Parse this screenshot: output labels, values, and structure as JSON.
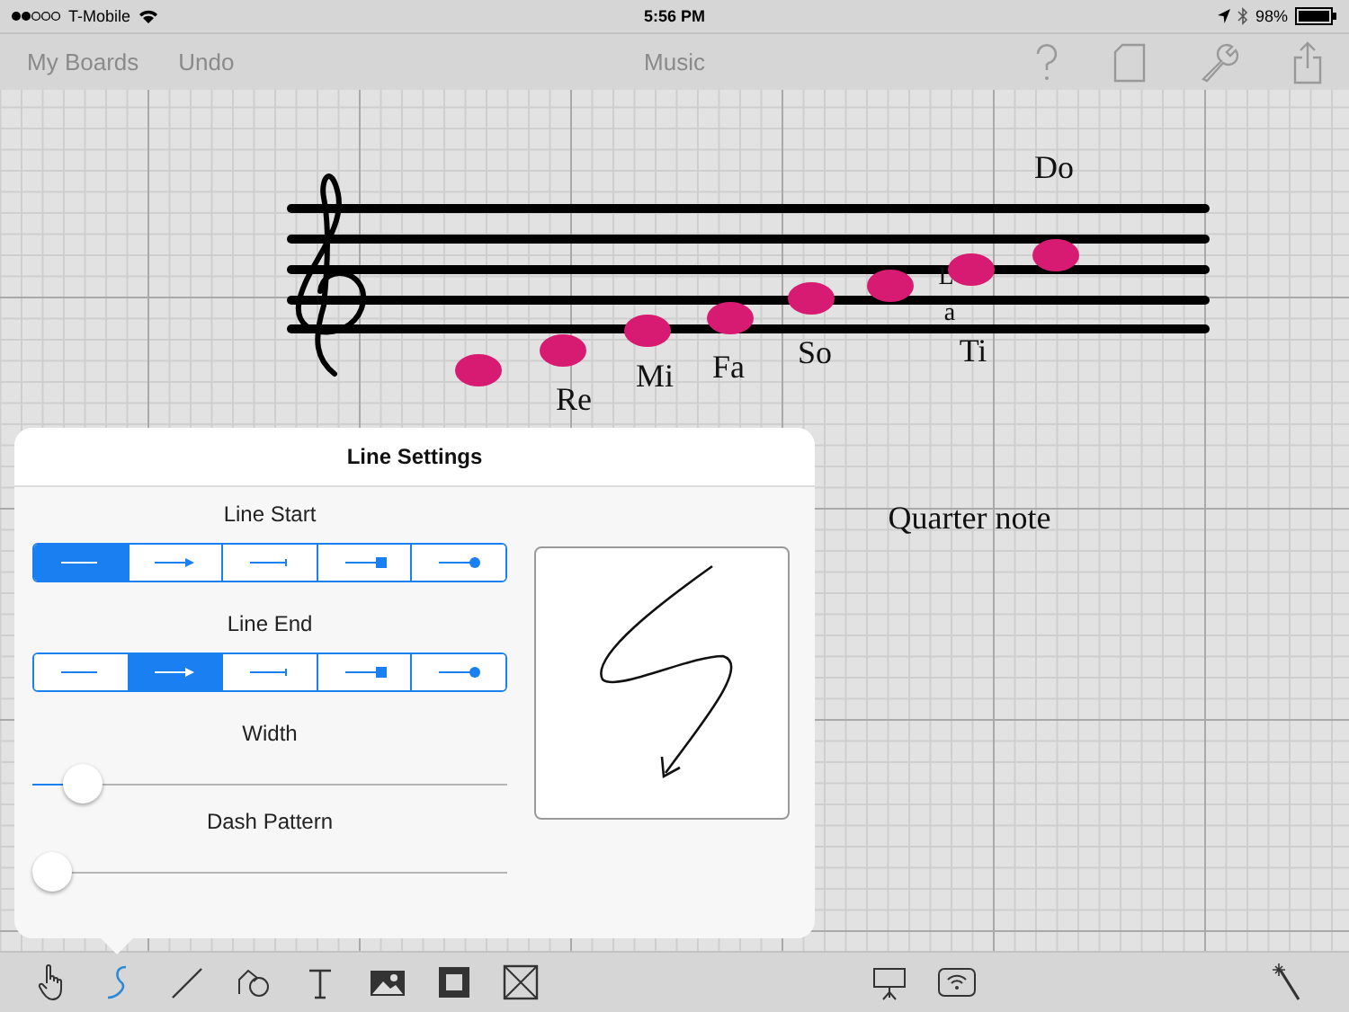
{
  "status_bar": {
    "carrier": "T-Mobile",
    "time": "5:56 PM",
    "battery": "98%"
  },
  "nav_bar": {
    "left_buttons": [
      "My Boards",
      "Undo"
    ],
    "title": "Music"
  },
  "canvas": {
    "labels": [
      "Do",
      "Re",
      "Mi",
      "Fa",
      "So",
      "L",
      "a",
      "Ti",
      "Quarter note"
    ]
  },
  "popover": {
    "title": "Line Settings",
    "line_start": {
      "label": "Line Start",
      "options": [
        {
          "kind": "plain",
          "selected": true
        },
        {
          "kind": "arrow",
          "selected": false
        },
        {
          "kind": "bar",
          "selected": false
        },
        {
          "kind": "square",
          "selected": false
        },
        {
          "kind": "circle",
          "selected": false
        }
      ]
    },
    "line_end": {
      "label": "Line End",
      "options": [
        {
          "kind": "plain",
          "selected": false
        },
        {
          "kind": "arrow",
          "selected": true
        },
        {
          "kind": "bar",
          "selected": false
        },
        {
          "kind": "square",
          "selected": false
        },
        {
          "kind": "circle",
          "selected": false
        }
      ]
    },
    "width": {
      "label": "Width",
      "level": 0.07
    },
    "dash_pattern": {
      "label": "Dash Pattern",
      "level": 0
    }
  },
  "toolbar": {
    "tools": [
      {
        "kind": "hand",
        "selected": false
      },
      {
        "kind": "freehand",
        "selected": true
      },
      {
        "kind": "line",
        "selected": false
      },
      {
        "kind": "shapes",
        "selected": false
      },
      {
        "kind": "text",
        "selected": false
      },
      {
        "kind": "image",
        "selected": false
      },
      {
        "kind": "frame",
        "selected": false
      },
      {
        "kind": "crossbox",
        "selected": false
      },
      {
        "kind": "presenter",
        "selected": false
      },
      {
        "kind": "wireless",
        "selected": false
      },
      {
        "kind": "wand",
        "selected": false
      }
    ]
  }
}
